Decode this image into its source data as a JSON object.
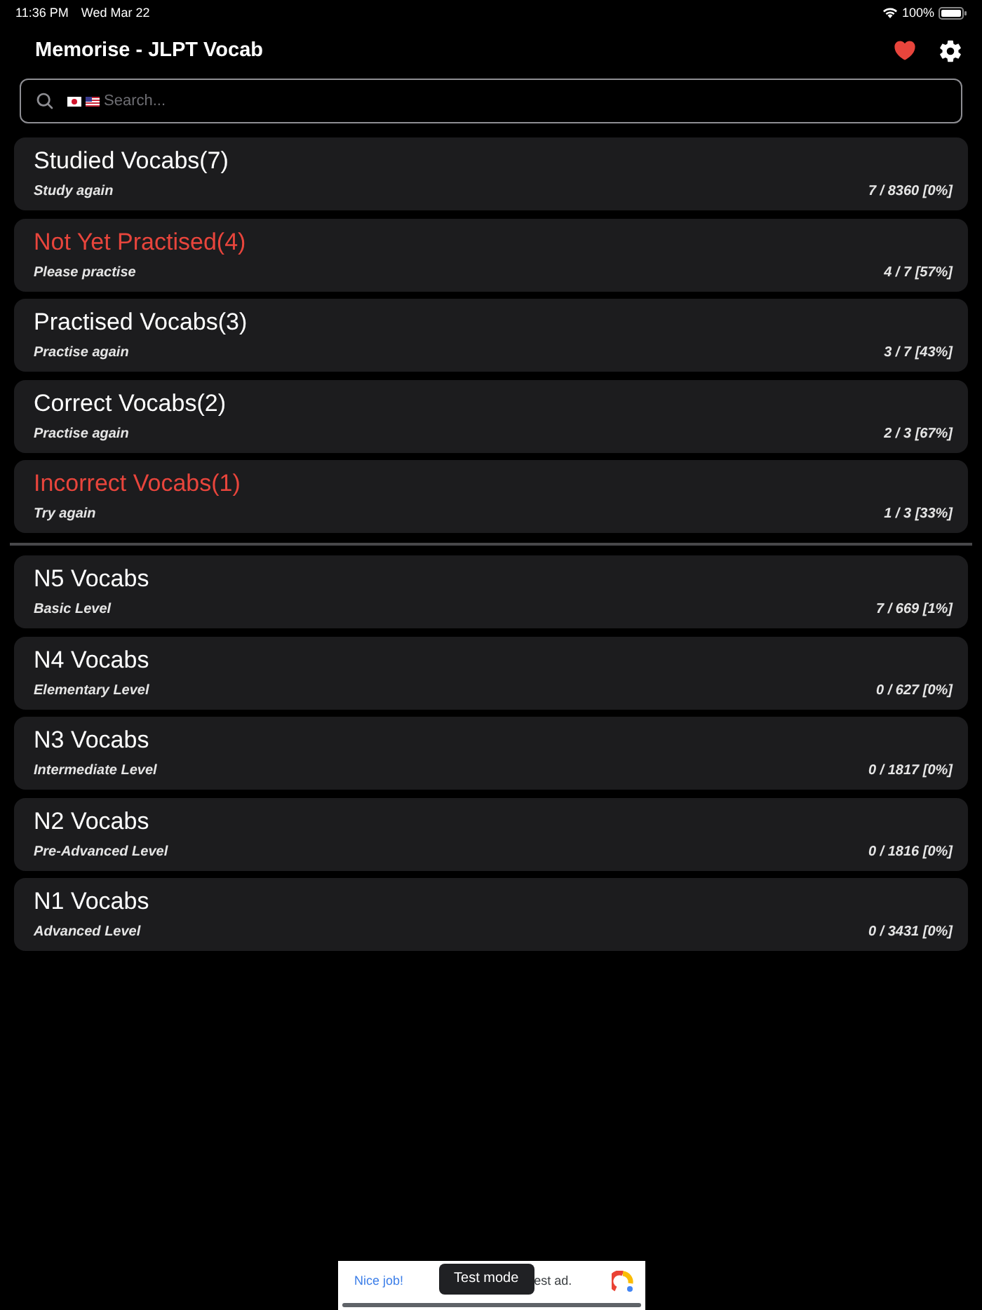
{
  "status_bar": {
    "time": "11:36 PM",
    "date": "Wed Mar 22",
    "battery": "100%"
  },
  "header": {
    "title": "Memorise - JLPT Vocab"
  },
  "search": {
    "placeholder": "Search..."
  },
  "progress_lists": [
    {
      "title": "Studied Vocabs(7)",
      "subtitle": "Study again",
      "reading": "7 / 8360 [0%]",
      "highlight": false
    },
    {
      "title": "Not Yet Practised(4)",
      "subtitle": "Please practise",
      "reading": "4 / 7 [57%]",
      "highlight": true
    },
    {
      "title": "Practised Vocabs(3)",
      "subtitle": "Practise again",
      "reading": "3 / 7 [43%]",
      "highlight": false
    },
    {
      "title": "Correct Vocabs(2)",
      "subtitle": "Practise again",
      "reading": "2 / 3 [67%]",
      "highlight": false
    },
    {
      "title": "Incorrect Vocabs(1)",
      "subtitle": "Try again",
      "reading": "1 / 3 [33%]",
      "highlight": true
    }
  ],
  "levels": [
    {
      "title": "N5 Vocabs",
      "subtitle": "Basic Level",
      "reading": "7 / 669 [1%]",
      "highlight": false
    },
    {
      "title": "N4 Vocabs",
      "subtitle": "Elementary Level",
      "reading": "0 / 627 [0%]",
      "highlight": false
    },
    {
      "title": "N3 Vocabs",
      "subtitle": "Intermediate Level",
      "reading": "0 / 1817 [0%]",
      "highlight": false
    },
    {
      "title": "N2 Vocabs",
      "subtitle": "Pre-Advanced Level",
      "reading": "0 / 1816 [0%]",
      "highlight": false
    },
    {
      "title": "N1 Vocabs",
      "subtitle": "Advanced Level",
      "reading": "0 / 3431 [0%]",
      "highlight": false
    }
  ],
  "ad": {
    "message": "Nice job!",
    "badge": "Test mode",
    "text": "est ad."
  }
}
